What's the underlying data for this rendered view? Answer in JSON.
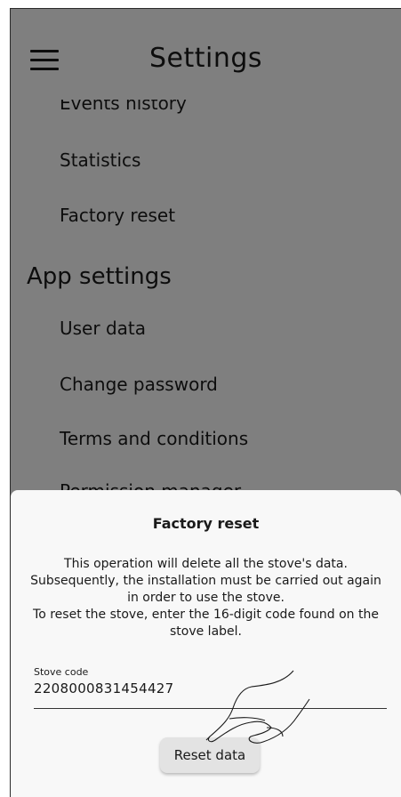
{
  "header": {
    "title": "Settings"
  },
  "menu": {
    "partial_top_item": "Events history",
    "items_top": [
      "Statistics",
      "Factory reset"
    ],
    "section_app": "App settings",
    "items_app": [
      "User data",
      "Change password",
      "Terms and conditions"
    ],
    "partial_bottom_item": "Permission manager"
  },
  "dialog": {
    "title": "Factory reset",
    "body_line1": "This operation will delete all the stove's data.",
    "body_line2": "Subsequently, the installation must be carried out again in order to use the stove.",
    "body_line3": "To reset the stove, enter the 16-digit code found on the stove label.",
    "field_label": "Stove code",
    "field_value": "2208000831454427",
    "button_label": "Reset data"
  },
  "colors": {
    "scrim": "#7f7f7f",
    "sheet": "#f8f8f8",
    "button": "#e3e3e3"
  },
  "icons": [
    "hamburger-menu-icon",
    "pointing-hand-icon"
  ]
}
